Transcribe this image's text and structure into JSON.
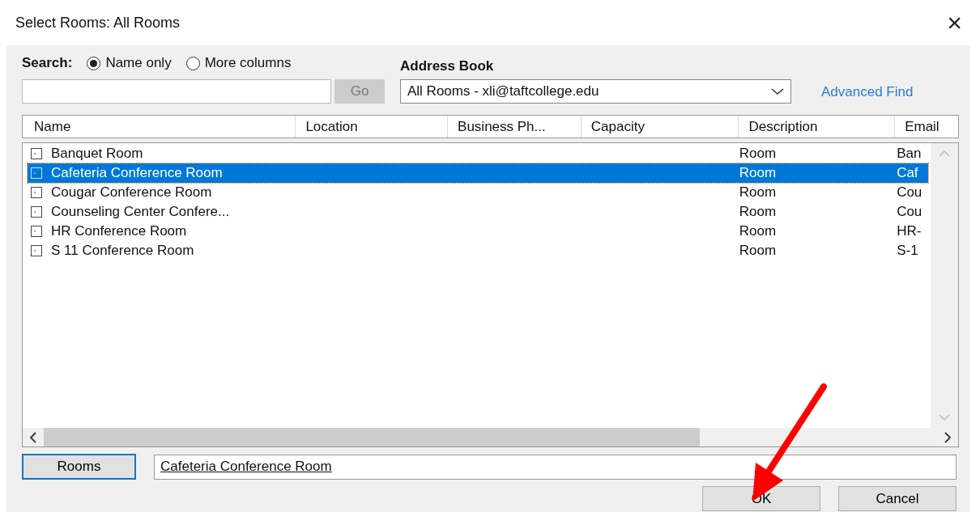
{
  "window": {
    "title": "Select Rooms: All Rooms",
    "close": "×"
  },
  "search": {
    "label": "Search:",
    "options": [
      {
        "label": "Name only",
        "selected": true
      },
      {
        "label": "More columns",
        "selected": false
      }
    ],
    "go": {
      "label": "Go",
      "disabled": true
    }
  },
  "address_book": {
    "label": "Address Book",
    "value": "All Rooms - xli@taftcollege.edu"
  },
  "advanced_find": "Advanced Find",
  "table": {
    "columns": [
      "Name",
      "Location",
      "Business Ph...",
      "Capacity",
      "Description",
      "Email"
    ],
    "rows": [
      {
        "name": "Banquet Room",
        "description": "Room",
        "email": "Ban",
        "selected": false
      },
      {
        "name": "Cafeteria Conference Room",
        "description": "Room",
        "email": "Caf",
        "selected": true
      },
      {
        "name": "Cougar Conference Room",
        "description": "Room",
        "email": "Cou",
        "selected": false
      },
      {
        "name": "Counseling Center Confere...",
        "description": "Room",
        "email": "Cou",
        "selected": false
      },
      {
        "name": "HR Conference Room",
        "description": "Room",
        "email": "HR-",
        "selected": false
      },
      {
        "name": "S 11 Conference Room",
        "description": "Room",
        "email": "S-1",
        "selected": false
      }
    ]
  },
  "rooms_button": "Rooms",
  "rooms_value": "Cafeteria Conference Room",
  "buttons": [
    "OK",
    "Cancel"
  ]
}
